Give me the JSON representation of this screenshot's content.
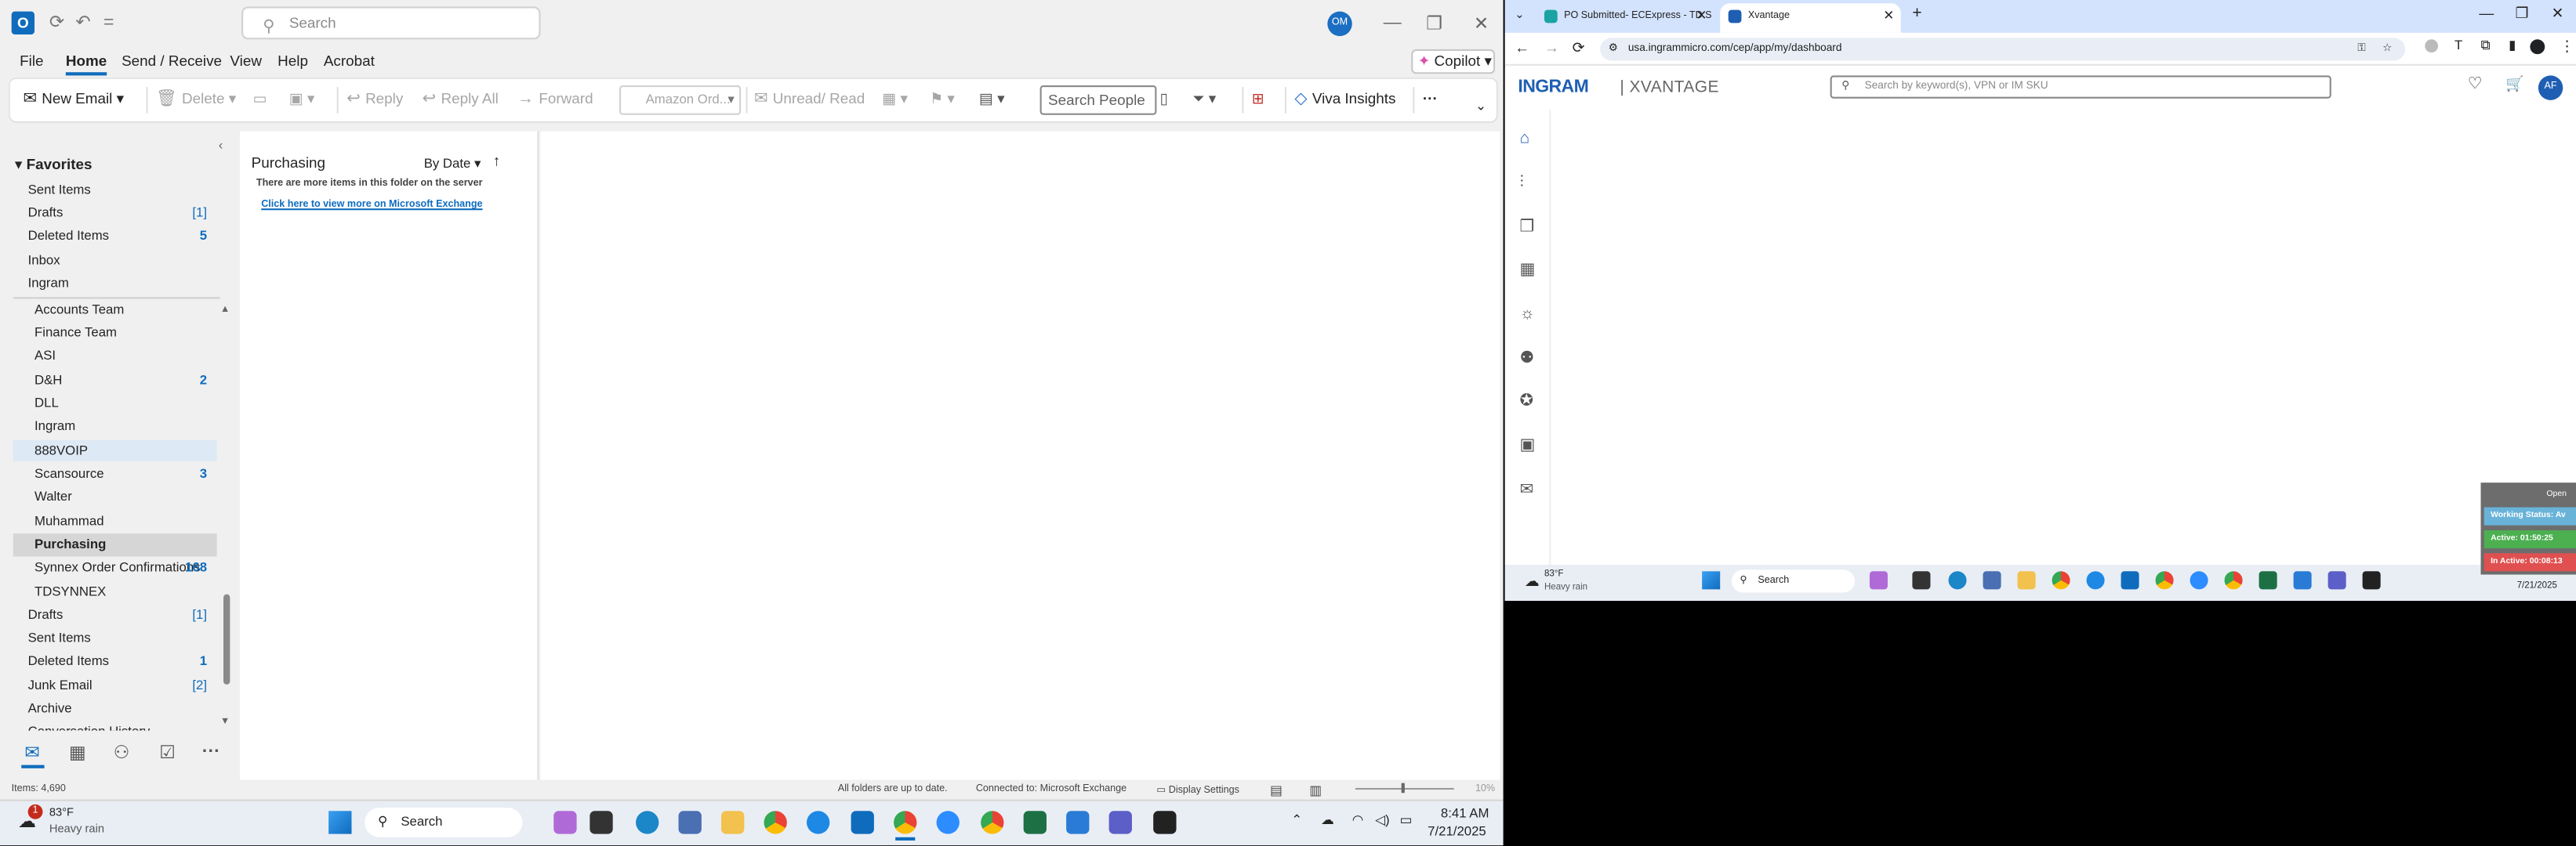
{
  "outlook": {
    "search_placeholder": "Search",
    "avatar": "OM",
    "menu": [
      "File",
      "Home",
      "Send / Receive",
      "View",
      "Help",
      "Acrobat"
    ],
    "copilot": "Copilot",
    "ribbon": {
      "new_email": "New Email",
      "delete": "Delete",
      "reply": "Reply",
      "reply_all": "Reply All",
      "forward": "Forward",
      "amazon": "Amazon Ord...",
      "unread_read": "Unread/ Read",
      "search_people": "Search People",
      "viva": "Viva Insights"
    },
    "favorites_header": "Favorites",
    "favorites": [
      {
        "label": "Sent Items",
        "count": ""
      },
      {
        "label": "Drafts",
        "count": "[1]"
      },
      {
        "label": "Deleted Items",
        "count": "5"
      },
      {
        "label": "Inbox",
        "count": ""
      },
      {
        "label": "Ingram",
        "count": ""
      }
    ],
    "folders": [
      {
        "label": "Accounts Team",
        "count": ""
      },
      {
        "label": "Finance Team",
        "count": ""
      },
      {
        "label": "ASI",
        "count": ""
      },
      {
        "label": "D&H",
        "count": "2"
      },
      {
        "label": "DLL",
        "count": ""
      },
      {
        "label": "Ingram",
        "count": ""
      },
      {
        "label": "888VOIP",
        "count": ""
      },
      {
        "label": "Scansource",
        "count": "3"
      },
      {
        "label": "Walter",
        "count": ""
      },
      {
        "label": "Muhammad",
        "count": ""
      },
      {
        "label": "Purchasing",
        "count": ""
      },
      {
        "label": "Synnex Order Confirmations",
        "count": "168"
      },
      {
        "label": "TDSYNNEX",
        "count": ""
      }
    ],
    "folders2": [
      {
        "label": "Drafts",
        "count": "[1]"
      },
      {
        "label": "Sent Items",
        "count": ""
      },
      {
        "label": "Deleted Items",
        "count": "1"
      },
      {
        "label": "Junk Email",
        "count": "[2]"
      },
      {
        "label": "Archive",
        "count": ""
      },
      {
        "label": "Conversation History",
        "count": ""
      }
    ],
    "message_list": {
      "folder": "Purchasing",
      "sort": "By Date",
      "server_note": "There are more items in this folder on the server",
      "exchange_link": "Click here to view more on Microsoft Exchange"
    },
    "status": {
      "items": "Items: 4,690",
      "sync": "All folders are up to date.",
      "connected": "Connected to: Microsoft Exchange",
      "display_settings": "Display Settings",
      "zoom": "10%"
    }
  },
  "taskbar": {
    "weather_temp": "83°F",
    "weather_desc": "Heavy rain",
    "weather_badge": "1",
    "search": "Search",
    "time": "8:41 AM",
    "date": "7/21/2025"
  },
  "chrome": {
    "tabs": [
      {
        "title": "PO Submitted- ECExpress - TD S"
      },
      {
        "title": "Xvantage"
      }
    ],
    "url": "usa.ingrammicro.com/cep/app/my/dashboard",
    "logo": "INGRAM",
    "logo2": "XVANTAGE",
    "search_placeholder": "Search by keyword(s), VPN or IM SKU",
    "avatar": "AF",
    "taskbar_temp": "83°F",
    "taskbar_desc": "Heavy rain",
    "taskbar_search": "Search",
    "taskbar_date": "7/21/2025"
  },
  "widget": {
    "open": "Open",
    "working": "Working Status: Av",
    "active": "Active: 01:50:25",
    "inactive": "In Active: 00:08:13"
  }
}
